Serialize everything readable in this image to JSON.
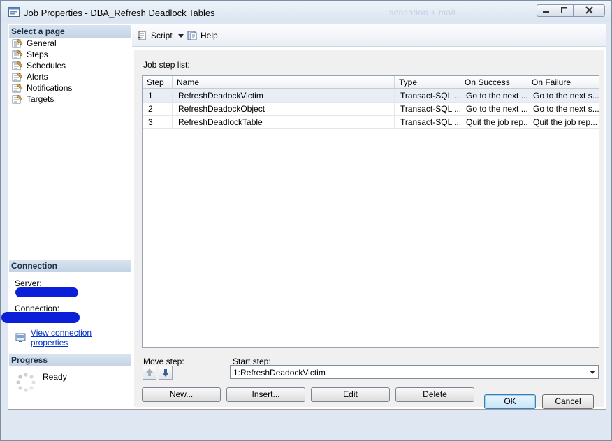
{
  "window": {
    "title": "Job Properties - DBA_Refresh Deadlock Tables",
    "background_blur_text": "sensation + mail"
  },
  "left": {
    "select_page_header": "Select a page",
    "pages": [
      {
        "label": "General",
        "icon": "page-icon"
      },
      {
        "label": "Steps",
        "icon": "page-icon"
      },
      {
        "label": "Schedules",
        "icon": "page-icon"
      },
      {
        "label": "Alerts",
        "icon": "page-icon"
      },
      {
        "label": "Notifications",
        "icon": "page-icon"
      },
      {
        "label": "Targets",
        "icon": "page-icon"
      }
    ],
    "connection_header": "Connection",
    "server_label": "Server:",
    "connection_label": "Connection:",
    "view_connection_link": "View connection properties",
    "progress_header": "Progress",
    "progress_status": "Ready"
  },
  "toolbar": {
    "script_label": "Script",
    "help_label": "Help"
  },
  "main": {
    "job_step_list_label": "Job step list:",
    "columns": [
      "Step",
      "Name",
      "Type",
      "On Success",
      "On Failure"
    ],
    "rows": [
      {
        "step": "1",
        "name": "RefreshDeadockVictim",
        "type": "Transact-SQL ...",
        "on_success": "Go to the next ...",
        "on_failure": "Go to the next s..."
      },
      {
        "step": "2",
        "name": "RefreshDeadockObject",
        "type": "Transact-SQL ...",
        "on_success": "Go to the next ...",
        "on_failure": "Go to the next s..."
      },
      {
        "step": "3",
        "name": "RefreshDeadlockTable",
        "type": "Transact-SQL ...",
        "on_success": "Quit the job rep...",
        "on_failure": "Quit the job rep..."
      }
    ],
    "move_step_label": "Move step:",
    "start_step_label": "Start step:",
    "start_step_value": "1:RefreshDeadockVictim",
    "buttons": {
      "new": "New...",
      "insert": "Insert...",
      "edit": "Edit",
      "delete": "Delete"
    }
  },
  "dialog": {
    "ok": "OK",
    "cancel": "Cancel"
  },
  "colors": {
    "accent": "#3c7fb1",
    "link": "#0033cc",
    "section_header": "#c3d4e6",
    "redaction": "#0b1fd8"
  }
}
